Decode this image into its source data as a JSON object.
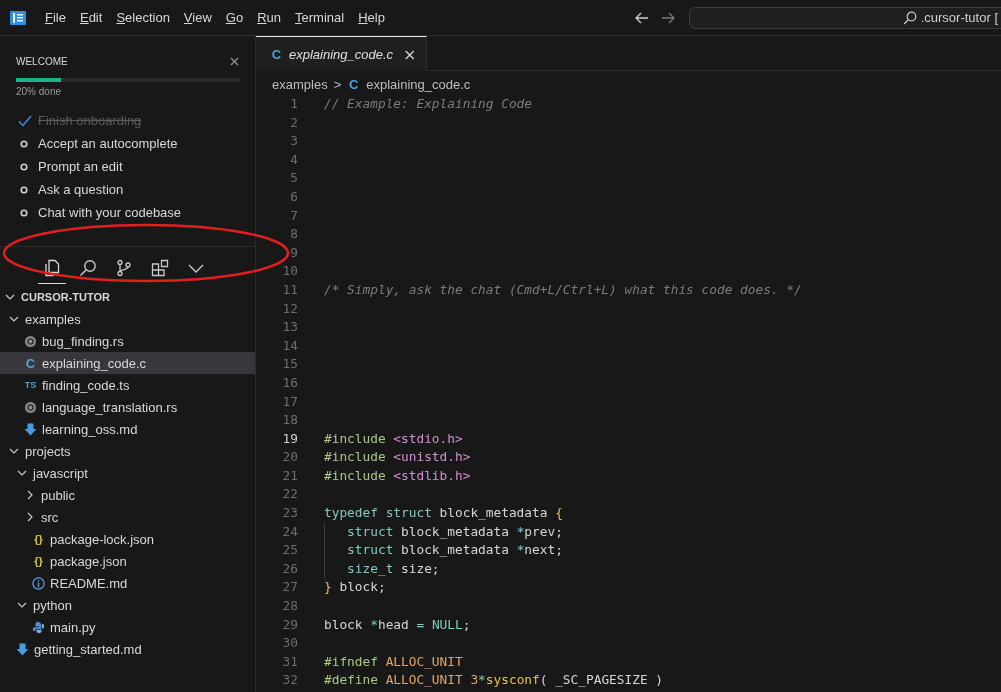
{
  "menu": [
    "File",
    "Edit",
    "Selection",
    "View",
    "Go",
    "Run",
    "Terminal",
    "Help"
  ],
  "command_center": {
    "value": ".cursor-tutor ["
  },
  "welcome": {
    "title": "WELCOME",
    "level": 0.2,
    "progress_text": "20% done",
    "items": [
      {
        "label": "Finish onboarding",
        "done": true
      },
      {
        "label": "Accept an autocomplete",
        "done": false
      },
      {
        "label": "Prompt an edit",
        "done": false
      },
      {
        "label": "Ask a question",
        "done": false
      },
      {
        "label": "Chat with your codebase",
        "done": false
      }
    ]
  },
  "activity": [
    {
      "kind": "files",
      "selected": true
    },
    {
      "kind": "search",
      "selected": false
    },
    {
      "kind": "source-control",
      "selected": false
    },
    {
      "kind": "extensions",
      "selected": false
    },
    {
      "kind": "more",
      "selected": false
    }
  ],
  "explorer": {
    "root": {
      "label": "CURSOR-TUTOR",
      "expanded": true,
      "children": [
        {
          "kind": "folder",
          "label": "examples",
          "expanded": true,
          "selected": false,
          "children": [
            {
              "kind": "rust",
              "label": "bug_finding.rs",
              "selected": false
            },
            {
              "kind": "c",
              "badge": "C",
              "label": "explaining_code.c",
              "selected": true
            },
            {
              "kind": "ts",
              "badge": "TS",
              "label": "finding_code.ts",
              "selected": false
            },
            {
              "kind": "rust",
              "label": "language_translation.rs",
              "selected": false
            },
            {
              "kind": "md",
              "label": "learning_oss.md",
              "selected": false
            }
          ]
        },
        {
          "kind": "folder",
          "label": "projects",
          "expanded": true,
          "selected": false,
          "children": [
            {
              "kind": "folder",
              "label": "javascript",
              "expanded": true,
              "selected": false,
              "children": [
                {
                  "kind": "folder",
                  "label": "public",
                  "expanded": false,
                  "selected": false
                },
                {
                  "kind": "folder",
                  "label": "src",
                  "expanded": false,
                  "selected": false
                },
                {
                  "kind": "json",
                  "badge": "{}",
                  "label": "package-lock.json",
                  "selected": false
                },
                {
                  "kind": "json",
                  "badge": "{}",
                  "label": "package.json",
                  "selected": false
                },
                {
                  "kind": "info",
                  "label": "README.md",
                  "selected": false
                }
              ]
            },
            {
              "kind": "folder",
              "label": "python",
              "expanded": true,
              "selected": false,
              "children": [
                {
                  "kind": "python",
                  "label": "main.py",
                  "selected": false
                }
              ]
            }
          ]
        },
        {
          "kind": "md",
          "label": "getting_started.md",
          "selected": false
        }
      ]
    }
  },
  "tab": {
    "badge": "C",
    "label": "explaining_code.c",
    "preview": true,
    "close": "×"
  },
  "breadcrumb": {
    "folder": "examples",
    "separator": ">",
    "badge": "C",
    "file": "explaining_code.c"
  },
  "code": [
    {
      "n": "1",
      "current": false,
      "tokens": [
        {
          "kind": "comment",
          "t": "// Example: Explaining Code"
        }
      ]
    },
    {
      "n": "2",
      "current": false
    },
    {
      "n": "3",
      "current": false
    },
    {
      "n": "4",
      "current": false
    },
    {
      "n": "5",
      "current": false
    },
    {
      "n": "6",
      "current": false
    },
    {
      "n": "7",
      "current": false
    },
    {
      "n": "8",
      "current": false
    },
    {
      "n": "9",
      "current": false
    },
    {
      "n": "10",
      "current": false
    },
    {
      "n": "11",
      "current": false,
      "tokens": [
        {
          "kind": "comment",
          "t": "/* Simply, ask the chat (Cmd+L/Ctrl+L) what this code does. */"
        }
      ]
    },
    {
      "n": "12",
      "current": false
    },
    {
      "n": "13",
      "current": false
    },
    {
      "n": "14",
      "current": false
    },
    {
      "n": "15",
      "current": false
    },
    {
      "n": "16",
      "current": false
    },
    {
      "n": "17",
      "current": false
    },
    {
      "n": "18",
      "current": false
    },
    {
      "n": "19",
      "current": true,
      "tokens": [
        {
          "kind": "directive",
          "t": "#include "
        },
        {
          "kind": "path",
          "t": "<stdio.h>"
        }
      ]
    },
    {
      "n": "20",
      "current": false,
      "tokens": [
        {
          "kind": "directive",
          "t": "#include "
        },
        {
          "kind": "path",
          "t": "<unistd.h>"
        }
      ]
    },
    {
      "n": "21",
      "current": false,
      "tokens": [
        {
          "kind": "directive",
          "t": "#include "
        },
        {
          "kind": "path",
          "t": "<stdlib.h>"
        }
      ]
    },
    {
      "n": "22",
      "current": false
    },
    {
      "n": "23",
      "current": false,
      "tokens": [
        {
          "kind": "keyword",
          "t": "typedef struct "
        },
        {
          "kind": "ident",
          "t": "block_metadata "
        },
        {
          "kind": "brace",
          "t": "{"
        }
      ]
    },
    {
      "n": "24",
      "current": false,
      "guide": true,
      "tokens": [
        {
          "kind": "keyword",
          "t": "   struct "
        },
        {
          "kind": "ident",
          "t": "block_metadata "
        },
        {
          "kind": "op",
          "t": "*"
        },
        {
          "kind": "ident",
          "t": "prev;"
        }
      ]
    },
    {
      "n": "25",
      "current": false,
      "guide": true,
      "tokens": [
        {
          "kind": "keyword",
          "t": "   struct "
        },
        {
          "kind": "ident",
          "t": "block_metadata "
        },
        {
          "kind": "op",
          "t": "*"
        },
        {
          "kind": "ident",
          "t": "next;"
        }
      ]
    },
    {
      "n": "26",
      "current": false,
      "guide": true,
      "tokens": [
        {
          "kind": "keyword",
          "t": "   size_t "
        },
        {
          "kind": "ident",
          "t": "size;"
        }
      ]
    },
    {
      "n": "27",
      "current": false,
      "tokens": [
        {
          "kind": "brace",
          "t": "} "
        },
        {
          "kind": "ident",
          "t": "block;"
        }
      ]
    },
    {
      "n": "28",
      "current": false
    },
    {
      "n": "29",
      "current": false,
      "tokens": [
        {
          "kind": "ident",
          "t": "block "
        },
        {
          "kind": "op",
          "t": "*"
        },
        {
          "kind": "ident",
          "t": "head "
        },
        {
          "kind": "op",
          "t": "= "
        },
        {
          "kind": "const",
          "t": "NULL"
        },
        {
          "kind": "ident",
          "t": ";"
        }
      ]
    },
    {
      "n": "30",
      "current": false
    },
    {
      "n": "31",
      "current": false,
      "tokens": [
        {
          "kind": "directive",
          "t": "#ifndef "
        },
        {
          "kind": "macro",
          "t": "ALLOC_UNIT"
        }
      ]
    },
    {
      "n": "32",
      "current": false,
      "tokens": [
        {
          "kind": "directive",
          "t": "#define "
        },
        {
          "kind": "macro",
          "t": "ALLOC_UNIT 3"
        },
        {
          "kind": "op",
          "t": "*"
        },
        {
          "kind": "func",
          "t": "sysconf"
        },
        {
          "kind": "ident",
          "t": "( _SC_PAGESIZE )"
        }
      ]
    }
  ],
  "annotation": {
    "kind": "ellipse"
  }
}
